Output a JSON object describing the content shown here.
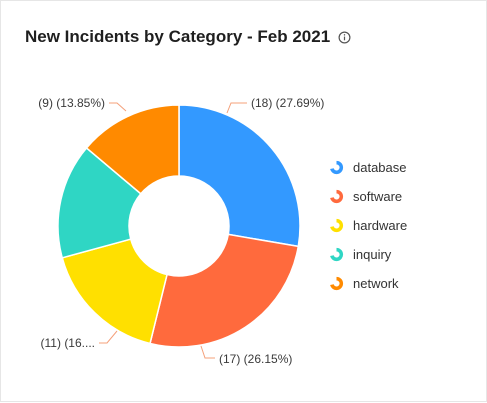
{
  "header": {
    "title": "New Incidents by Category - Feb 2021",
    "info_icon": "info-circle-icon"
  },
  "chart_data": {
    "type": "pie",
    "donut": true,
    "title": "New Incidents by Category - Feb 2021",
    "legend_position": "right",
    "slices": [
      {
        "label": "database",
        "value": 18,
        "percent": 27.69,
        "callout": "(18) (27.69%)",
        "color": "#3399ff"
      },
      {
        "label": "software",
        "value": 17,
        "percent": 26.15,
        "callout": "(17) (26.15%)",
        "color": "#ff6a3d"
      },
      {
        "label": "hardware",
        "value": 11,
        "percent": 16.92,
        "callout": "(11) (16....",
        "color": "#ffe000"
      },
      {
        "label": "inquiry",
        "value": 10,
        "percent": 15.38,
        "callout": "",
        "color": "#2fd6c4"
      },
      {
        "label": "network",
        "value": 9,
        "percent": 13.85,
        "callout": "(9) (13.85%)",
        "color": "#ff8a00"
      }
    ]
  }
}
